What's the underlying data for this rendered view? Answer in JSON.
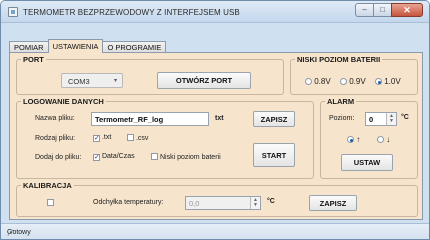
{
  "window": {
    "title": "TERMOMETR BEZPRZEWODOWY Z INTERFEJSEM USB",
    "close_glyph": "✕",
    "min_glyph": "–",
    "max_glyph": "□"
  },
  "tabs": [
    {
      "label": "POMIAR"
    },
    {
      "label": "USTAWIENIA",
      "active": true
    },
    {
      "label": "O PROGRAMIE"
    }
  ],
  "port": {
    "legend": "PORT",
    "selected": "COM3",
    "open_button": "OTWÓRZ PORT"
  },
  "battery": {
    "legend": "NISKI POZIOM BATERII",
    "options": [
      "0.8V",
      "0.9V",
      "1.0V"
    ],
    "selected": "1.0V"
  },
  "logging": {
    "legend": "LOGOWANIE DANYCH",
    "file_name_label": "Nazwa pliku:",
    "file_name_value": "Termometr_RF_log",
    "file_ext": "txt",
    "save_button": "ZAPISZ",
    "file_type_label": "Rodzaj pliku:",
    "file_types": [
      {
        "label": ".txt",
        "checked": true
      },
      {
        "label": ".csv",
        "checked": false
      }
    ],
    "add_label": "Dodaj do pliku:",
    "add_options": [
      {
        "label": "Data/Czas",
        "checked": true
      },
      {
        "label": "Niski poziom baterii",
        "checked": false
      }
    ],
    "start_button": "START"
  },
  "alarm": {
    "legend": "ALARM",
    "level_label": "Poziom:",
    "level_value": "0",
    "unit": "°C",
    "dir_up": "↑",
    "dir_down": "↓",
    "selected_direction": "up",
    "set_button": "USTAW"
  },
  "calibration": {
    "legend": "KALIBRACJA",
    "deviation_label": "Odchyłka temperatury:",
    "deviation_value": "0,0",
    "unit": "°C",
    "save_button": "ZAPISZ"
  },
  "status": {
    "text": "Gotowy"
  },
  "icons": {
    "app": "thermometer-app-icon",
    "checkmark": "✓",
    "dropdown": "▾",
    "spin_up": "▲",
    "spin_down": "▼"
  },
  "colors": {
    "panel_bg": "#f6e4cc",
    "window_bg": "#cfe0f0",
    "close_button": "#c6553d"
  }
}
